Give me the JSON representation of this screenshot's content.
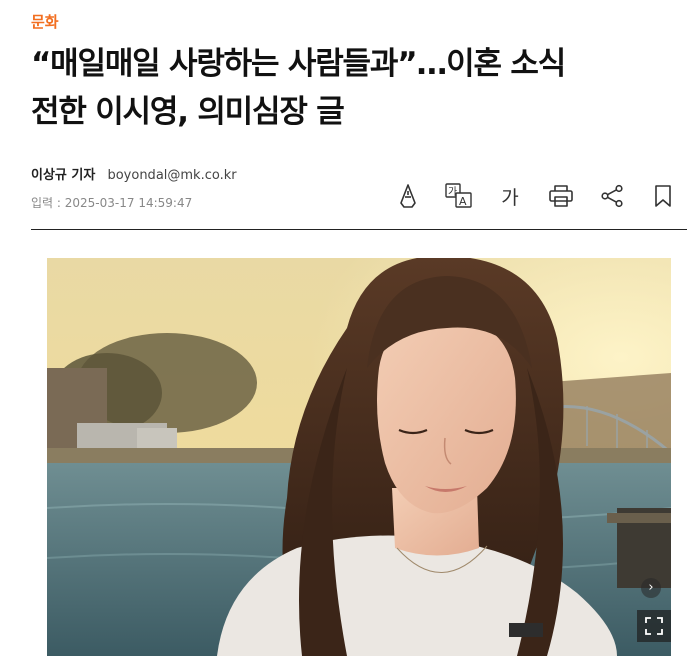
{
  "article": {
    "category": "문화",
    "headline_line1": "“매일매일 사랑하는 사람들과”…이혼 소식",
    "headline_line2": "전한 이시영, 의미심장 글",
    "reporter": "이상규 기자",
    "email": "boyondal@mk.co.kr",
    "date_label": "입력",
    "date_sep": " : ",
    "date": "2025-03-17 14:59:47"
  },
  "toolbar": {
    "font_size_label": "가",
    "icons": [
      "highlighter-icon",
      "translate-icon",
      "font-size-icon",
      "print-icon",
      "share-icon",
      "bookmark-icon"
    ],
    "translate_glyph_top": "가",
    "translate_glyph_bottom": "A"
  },
  "photo": {
    "next_glyph": "›",
    "icons": [
      "chevron-right-icon",
      "expand-icon"
    ]
  },
  "colors": {
    "accent": "#f26f21",
    "text": "#111111",
    "muted": "#888888"
  }
}
